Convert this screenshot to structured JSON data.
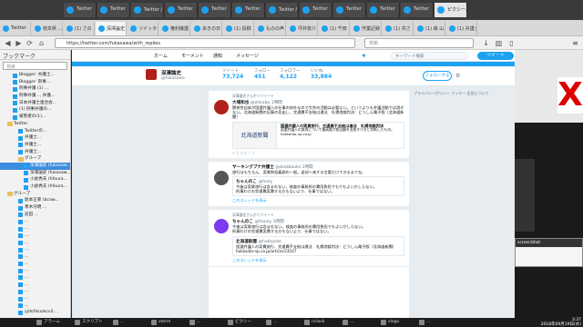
{
  "os_tabs": [
    {
      "label": "Twitter"
    },
    {
      "label": "Twitter"
    },
    {
      "label": "Twitter / 岐阜 #..."
    },
    {
      "label": "Twitter"
    },
    {
      "label": "Twitter"
    },
    {
      "label": "Twitter"
    },
    {
      "label": "Twitter / 2 通..."
    },
    {
      "label": "Twitter"
    },
    {
      "label": "Twitter"
    },
    {
      "label": "Twitter"
    },
    {
      "label": "Twitter"
    },
    {
      "label": "ピクシー..."
    }
  ],
  "ff_tabs": [
    {
      "label": "Twitter"
    },
    {
      "label": "岐阜県 ..."
    },
    {
      "label": "(1) さの"
    },
    {
      "label": "深澤論史"
    },
    {
      "label": "ツイッター"
    },
    {
      "label": "権利擁護"
    },
    {
      "label": "あきの日"
    },
    {
      "label": "(1) 投稿"
    },
    {
      "label": "ものの声"
    },
    {
      "label": "坪井俊介"
    },
    {
      "label": "(1) 千田"
    },
    {
      "label": "作業記録"
    },
    {
      "label": "(1) 共さ"
    },
    {
      "label": "(1) 森 山"
    },
    {
      "label": "(1) 弁護士"
    }
  ],
  "nav": {
    "url": "https://twitter.com/fukasawa/with_replies",
    "search_placeholder": "検索"
  },
  "sidebar": {
    "title": "ブックマーク",
    "search_placeholder": "検索",
    "items": [
      {
        "label": "Blogger: 弁護士...",
        "type": "sq",
        "indent": 14
      },
      {
        "label": "Blogger: 刑事...",
        "type": "sq",
        "indent": 14
      },
      {
        "label": "刑事弁護 (1) ...",
        "type": "sq",
        "indent": 14
      },
      {
        "label": "刑事弁護..., 弁護...",
        "type": "sq",
        "indent": 14
      },
      {
        "label": "日本弁護士連合会...",
        "type": "sq",
        "indent": 14
      },
      {
        "label": "(1) 刑事弁護の...",
        "type": "sq",
        "indent": 14
      },
      {
        "label": "被害者の(1)...",
        "type": "sq",
        "indent": 14
      },
      {
        "label": "Twitter",
        "type": "fold",
        "indent": 8
      },
      {
        "label": "Twitterの...",
        "type": "sq",
        "indent": 20
      },
      {
        "label": "弁護士...",
        "type": "sq",
        "indent": 20
      },
      {
        "label": "弁護士...",
        "type": "sq",
        "indent": 20
      },
      {
        "label": "弁護士...",
        "type": "sq",
        "indent": 20
      },
      {
        "label": "グループ",
        "type": "fold",
        "indent": 20
      },
      {
        "label": "深澤論史 (fukasaw...",
        "type": "sq",
        "indent": 26,
        "selected": true
      },
      {
        "label": "深澤論史 (fukasaw...",
        "type": "sq",
        "indent": 26
      },
      {
        "label": "小倉秀夫 (hfoura...",
        "type": "sq",
        "indent": 26
      },
      {
        "label": "小倉秀夫 (hfoura...",
        "type": "sq",
        "indent": 26
      },
      {
        "label": "グループ",
        "type": "fold",
        "indent": 8
      },
      {
        "label": "坂本正幸 (bcaw...",
        "type": "sq",
        "indent": 20
      },
      {
        "label": "青木守明 ...",
        "type": "sq",
        "indent": 20
      },
      {
        "label": "前田 ...",
        "type": "sq",
        "indent": 20
      },
      {
        "label": "...",
        "type": "sq",
        "indent": 20
      },
      {
        "label": "...",
        "type": "sq",
        "indent": 20
      },
      {
        "label": "...",
        "type": "sq",
        "indent": 20
      },
      {
        "label": "...",
        "type": "sq",
        "indent": 20
      },
      {
        "label": "...",
        "type": "sq",
        "indent": 20
      },
      {
        "label": "...",
        "type": "sq",
        "indent": 20
      },
      {
        "label": "...",
        "type": "sq",
        "indent": 20
      },
      {
        "label": "...",
        "type": "sq",
        "indent": 20
      },
      {
        "label": "...",
        "type": "sq",
        "indent": 20
      },
      {
        "label": "...",
        "type": "sq",
        "indent": 20
      },
      {
        "label": "...",
        "type": "sq",
        "indent": 20
      },
      {
        "label": "...",
        "type": "sq",
        "indent": 20
      },
      {
        "label": "...",
        "type": "sq",
        "indent": 20
      },
      {
        "label": "yjdsXkuokcv2...",
        "type": "sq",
        "indent": 20
      }
    ]
  },
  "twitter": {
    "nav": {
      "home": "ホーム",
      "moments": "モーメント",
      "notifications": "通知",
      "messages": "メッセージ"
    },
    "search_placeholder": "キーワード検索",
    "tweet_button": "ツイート",
    "profile": {
      "name": "深澤論史",
      "handle": "@fukasawa",
      "stats": [
        {
          "label": "ツイート",
          "value": "73,724"
        },
        {
          "label": "フォロー",
          "value": "451"
        },
        {
          "label": "フォロワー",
          "value": "4,122"
        },
        {
          "label": "いいね",
          "value": "33,884"
        }
      ],
      "follow_button": "フォローする"
    },
    "right_text": "プライバシーポリシー クッキー 広告について",
    "tweets": [
      {
        "rt": "深澤論史さんがリツイート",
        "name": "大場和也",
        "handle": "@ohkabo",
        "time": "1時間",
        "text": "関係性自体が国選弁護人の仕事の枠外なので大弁の活動は必要ない。というよりも弁護活動では過ぎない。北海道新聞の記事の見出し、交通費不支給は違法　札幌地裁判決：どうしん電子版（北海道新聞）",
        "card_logo": "北海道新聞",
        "card_title": "国選弁護人の実費旅行、交通費不支給は違法　札幌地裁判決",
        "card_text": "国選弁護人の旅費について最高裁が相当額を支給すべきと判断したもの。hokkaido-np.co.jp",
        "acts": "↩ 1   ⟲ 4   ♡ 3"
      },
      {
        "rt": "",
        "name": "サーキングブナ弁護士",
        "handle": "@skatbooks",
        "time": "1時間",
        "text": "旅行はもちろん、実質負担義務の一般。返却へ来する言葉だけできるまでな。",
        "quote_name": "ちゃんのこ",
        "quote_handle": "@fooly",
        "quote_text": "今後は実質旅行は含まれない。検査の事務所の費用負担でもでもよいかしらない。",
        "quote_more": "刑事わけの交通費実費する方もないより、仕事ではない。",
        "rep": "このスレッドを表示",
        "acts": "↩   ⟲   ♡"
      },
      {
        "rt": "深澤論史さんがリツイート",
        "name": "ちゃんのこ",
        "handle": "@foooly",
        "time": "1時間",
        "text": "今後は実質旅行は含まれない。検査の事務所の費用負担でもよいかしらない。",
        "text2": "刑事わけの交通費実費する方もないより、仕事ではない。",
        "quote_name": "北海道新聞",
        "quote_handle": "@hokkaido",
        "quote_text": "国選弁護人の実費旅行、交通費不支給は違法　札幌地裁判決：どうしん電子版（北海道新聞）hokkaido-np.co.jp/article/23547",
        "rep": "このスレッドを表示"
      }
    ]
  },
  "taskbar": {
    "items": [
      "アラーム",
      "スクリプト",
      "...",
      "xterm",
      "...",
      "ピクシー",
      "...",
      "nclock",
      "...",
      "xlogo",
      "..."
    ],
    "clock_time": "3:37",
    "clock_date": "2018年09月19日(水)"
  },
  "right_panel": {
    "x_mark": "X",
    "dialog_title": "screenShot"
  }
}
